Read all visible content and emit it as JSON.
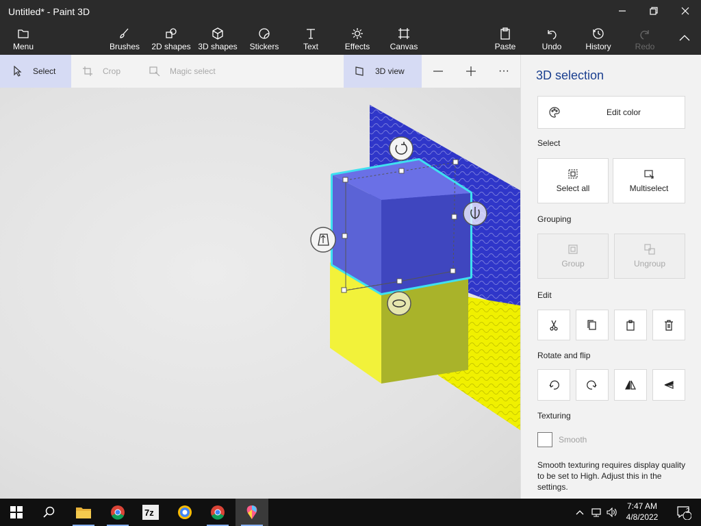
{
  "window": {
    "title": "Untitled* - Paint 3D"
  },
  "ribbon": {
    "menu": "Menu",
    "brushes": "Brushes",
    "shapes2d": "2D shapes",
    "shapes3d": "3D shapes",
    "stickers": "Stickers",
    "text": "Text",
    "effects": "Effects",
    "canvas": "Canvas",
    "paste": "Paste",
    "undo": "Undo",
    "history": "History",
    "redo": "Redo"
  },
  "toolbar": {
    "select": "Select",
    "crop": "Crop",
    "magic_select": "Magic select",
    "view3d": "3D view",
    "more": "···"
  },
  "panel": {
    "title": "3D selection",
    "edit_color": "Edit color",
    "select_label": "Select",
    "select_all": "Select all",
    "multiselect": "Multiselect",
    "grouping_label": "Grouping",
    "group": "Group",
    "ungroup": "Ungroup",
    "edit_label": "Edit",
    "rotate_label": "Rotate and flip",
    "texturing_label": "Texturing",
    "smooth": "Smooth",
    "smooth_checked": false,
    "note": "Smooth texturing requires display quality to be set to High. Adjust this in the settings."
  },
  "colors": {
    "cube_blue": "#5b63d6",
    "cube_yellow": "#f2f23a",
    "selection_glow": "#3fe0f0",
    "wall_blue": "#2f36c9",
    "accent": "#1a3f8f"
  },
  "taskbar": {
    "apps": [
      "start-icon",
      "search-icon",
      "file-explorer-icon",
      "chrome-icon",
      "7zip-icon",
      "brave-icon",
      "chrome-icon",
      "paint3d-icon"
    ],
    "time": "7:47 AM",
    "date": "4/8/2022",
    "notification_count": "2"
  }
}
